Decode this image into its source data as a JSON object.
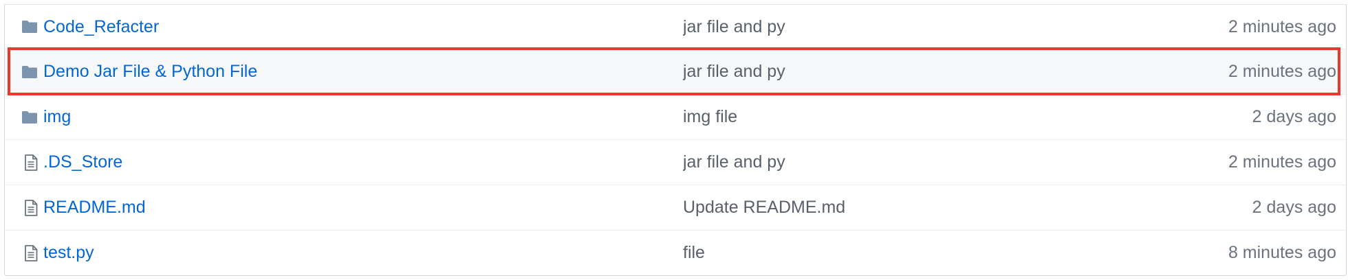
{
  "colors": {
    "link": "#0366d6",
    "message": "#586069",
    "age": "#6a737d",
    "folder_icon": "#79b8ff",
    "file_icon": "#6a737d",
    "highlight_border": "#e8392b",
    "highlight_row_bg": "#f6f8fa",
    "row_divider": "#eaecef"
  },
  "files": [
    {
      "type": "folder",
      "icon": "folder-icon",
      "name": "Code_Refacter",
      "message": "jar file and py",
      "age": "2 minutes ago"
    },
    {
      "type": "folder",
      "icon": "folder-icon",
      "name": "Demo Jar File & Python File",
      "message": "jar file and py",
      "age": "2 minutes ago"
    },
    {
      "type": "folder",
      "icon": "folder-icon",
      "name": "img",
      "message": "img file",
      "age": "2 days ago"
    },
    {
      "type": "file",
      "icon": "file-icon",
      "name": ".DS_Store",
      "message": "jar file and py",
      "age": "2 minutes ago"
    },
    {
      "type": "file",
      "icon": "file-icon",
      "name": "README.md",
      "message": "Update README.md",
      "age": "2 days ago"
    },
    {
      "type": "file",
      "icon": "file-icon",
      "name": "test.py",
      "message": "file",
      "age": "8 minutes ago"
    }
  ]
}
